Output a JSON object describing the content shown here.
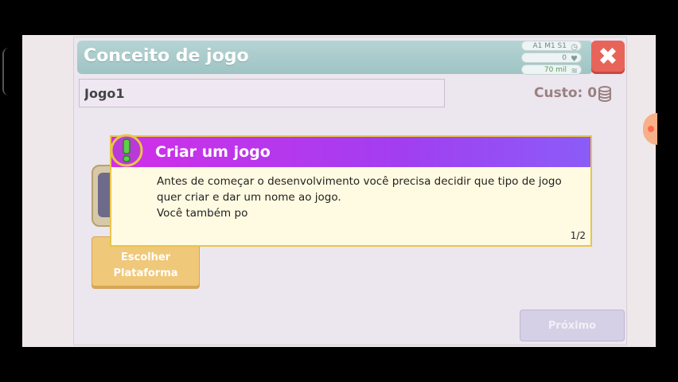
{
  "panel": {
    "title": "Conceito de jogo",
    "stats": [
      {
        "label": "A1 M1 S1",
        "icon": "clock-icon"
      },
      {
        "label": "0",
        "icon": "heart-icon"
      },
      {
        "label": "70 mil",
        "icon": "coins-icon"
      }
    ],
    "game_name_value": "Jogo1",
    "cost_label": "Custo: 0",
    "platform_button": "Escolher Plataforma",
    "next_button": "Próximo",
    "close_icon": "close-icon"
  },
  "tutorial": {
    "title": "Criar um jogo",
    "lines": [
      "Antes de começar o desenvolvimento você precisa decidir que tipo de jogo",
      "quer criar e dar um nome ao jogo.",
      "Você também po"
    ],
    "page": "1/2",
    "badge_icon": "exclamation-icon"
  },
  "colors": {
    "title_bar": "#9fc3c3",
    "close_button": "#e8645a",
    "tutorial_header_start": "#d12fe8",
    "tutorial_header_end": "#8b5cf7",
    "platform_button": "#f0c87a"
  }
}
